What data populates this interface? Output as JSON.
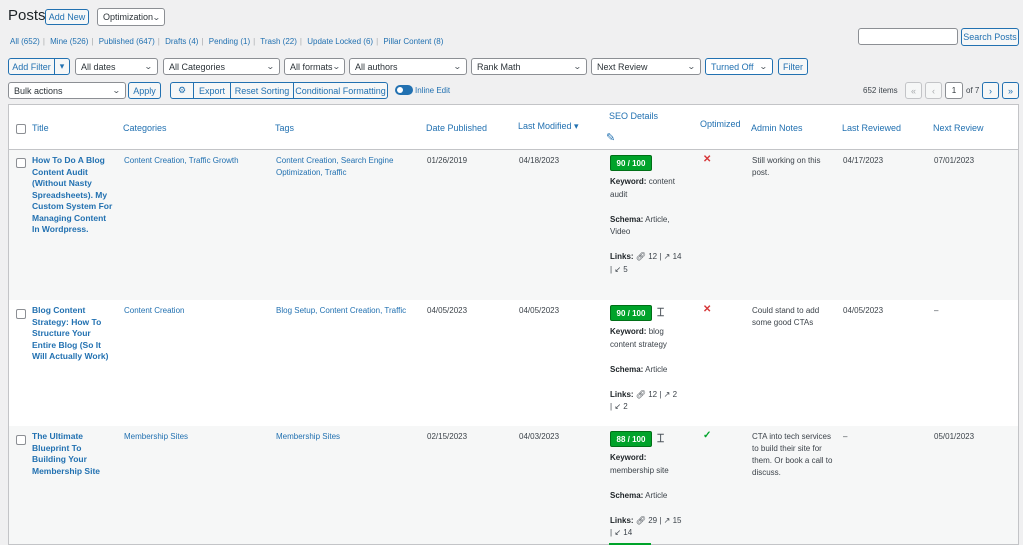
{
  "header": {
    "title": "Posts",
    "add_new": "Add New",
    "optimization": "Optimization"
  },
  "filters_links": [
    {
      "label": "All",
      "count": "(652)"
    },
    {
      "label": "Mine",
      "count": "(526)"
    },
    {
      "label": "Published",
      "count": "(647)"
    },
    {
      "label": "Drafts",
      "count": "(4)"
    },
    {
      "label": "Pending",
      "count": "(1)"
    },
    {
      "label": "Trash",
      "count": "(22)"
    },
    {
      "label": "Update Locked",
      "count": "(6)"
    },
    {
      "label": "Pillar Content",
      "count": "(8)"
    }
  ],
  "search": {
    "button": "Search Posts",
    "value": ""
  },
  "toolbar": {
    "add_filter": "Add Filter",
    "dates": "All dates",
    "categories": "All Categories",
    "formats": "All formats",
    "authors": "All authors",
    "seo_plugin": "Rank Math",
    "review": "Next Review",
    "turned_off": "Turned Off",
    "filter": "Filter",
    "bulk_actions": "Bulk actions",
    "apply": "Apply",
    "export": "Export",
    "reset_sorting": "Reset Sorting",
    "conditional_formatting": "Conditional Formatting",
    "inline_edit": "Inline Edit"
  },
  "pagination": {
    "items": "652 items",
    "first": "«",
    "prev": "‹",
    "current": "1",
    "of": "of 7",
    "next": "›",
    "last": "»"
  },
  "columns": {
    "title": "Title",
    "categories": "Categories",
    "tags": "Tags",
    "date_published": "Date Published",
    "last_modified": "Last Modified",
    "seo_details": "SEO Details",
    "optimized": "Optimized",
    "admin_notes": "Admin Notes",
    "last_reviewed": "Last Reviewed",
    "next_review": "Next Review"
  },
  "labels": {
    "keyword": "Keyword:",
    "schema": "Schema:",
    "links": "Links:"
  },
  "rows": [
    {
      "title": "How To Do A Blog Content Audit (Without Nasty Spreadsheets). My Custom System For Managing Content In Wordpress.",
      "categories": "Content Creation, Traffic Growth",
      "tags": "Content Creation, Search Engine Optimization, Traffic",
      "published": "01/26/2019",
      "modified": "04/18/2023",
      "score": "90 / 100",
      "keyword": "content audit",
      "schema": "Article, Video",
      "links_internal": "12",
      "links_external": "14",
      "links_incoming": "5",
      "optimized": "no",
      "notes": "Still working on this post.",
      "last_reviewed": "04/17/2023",
      "next_review": "07/01/2023"
    },
    {
      "title": "Blog Content Strategy: How To Structure Your Entire Blog (So It Will Actually Work)",
      "categories": "Content Creation",
      "tags": "Blog Setup, Content Creation, Traffic",
      "published": "04/05/2023",
      "modified": "04/05/2023",
      "score": "90 / 100",
      "keyword": "blog content strategy",
      "schema": "Article",
      "links_internal": "12",
      "links_external": "2",
      "links_incoming": "2",
      "optimized": "no",
      "notes": "Could stand to add some good CTAs",
      "last_reviewed": "04/05/2023",
      "next_review": "–"
    },
    {
      "title": "The Ultimate Blueprint To Building Your Membership Site",
      "categories": "Membership Sites",
      "tags": "Membership Sites",
      "published": "02/15/2023",
      "modified": "04/03/2023",
      "score": "88 / 100",
      "keyword": "membership site",
      "schema": "Article",
      "links_internal": "29",
      "links_external": "15",
      "links_incoming": "14",
      "optimized": "yes",
      "notes": "CTA into tech services to build their site for them. Or book a call to discuss.",
      "last_reviewed": "–",
      "next_review": "05/01/2023"
    }
  ]
}
